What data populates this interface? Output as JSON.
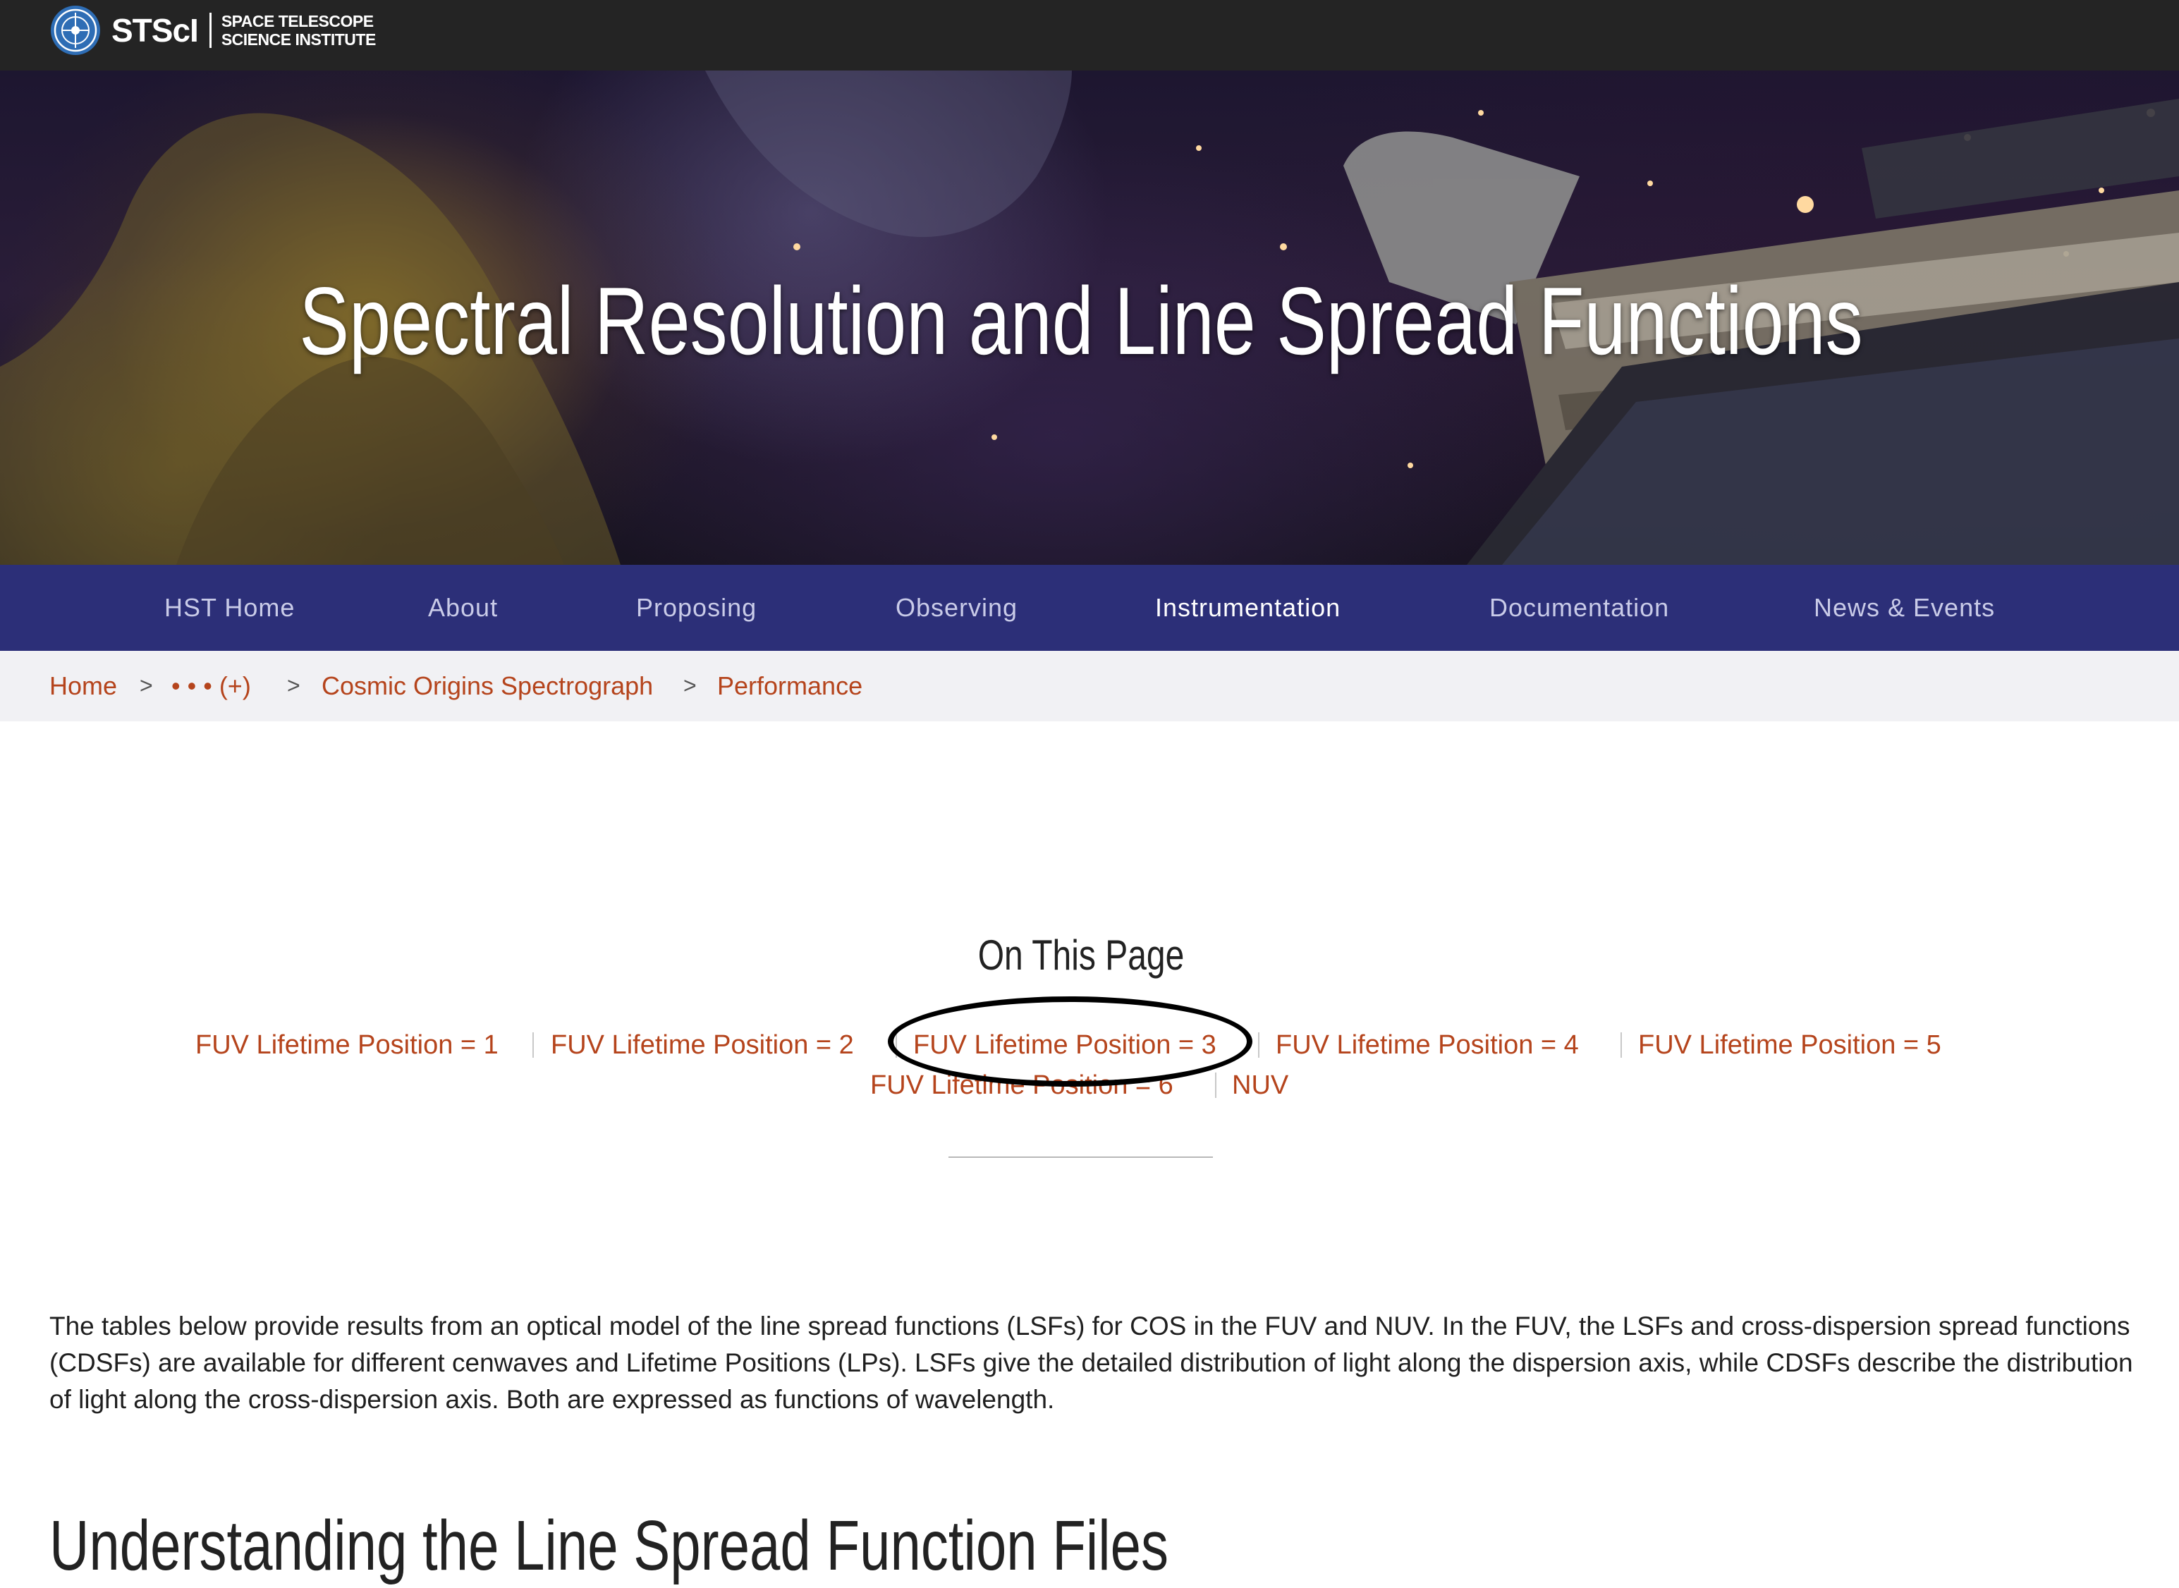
{
  "topbar": {
    "logo_text": "STScI",
    "logo_subtitle_line1": "SPACE TELESCOPE",
    "logo_subtitle_line2": "SCIENCE INSTITUTE"
  },
  "hero": {
    "title": "Spectral Resolution and Line Spread Functions"
  },
  "nav": {
    "items": [
      {
        "label": "HST Home"
      },
      {
        "label": "About"
      },
      {
        "label": "Proposing"
      },
      {
        "label": "Observing"
      },
      {
        "label": "Instrumentation",
        "active": true
      },
      {
        "label": "Documentation"
      },
      {
        "label": "News & Events"
      }
    ]
  },
  "breadcrumb": {
    "separator": ">",
    "items": [
      {
        "label": "Home"
      },
      {
        "label": "• • • (+)"
      },
      {
        "label": "Cosmic Origins Spectrograph"
      },
      {
        "label": "Performance"
      }
    ]
  },
  "on_this_page": {
    "title": "On This Page",
    "links": [
      {
        "label": "FUV Lifetime Position = 1"
      },
      {
        "label": "FUV Lifetime Position = 2"
      },
      {
        "label": "FUV Lifetime Position = 3"
      },
      {
        "label": "FUV Lifetime Position = 4"
      },
      {
        "label": "FUV Lifetime Position = 5"
      },
      {
        "label": "FUV Lifetime Position = 6"
      },
      {
        "label": "NUV"
      }
    ]
  },
  "content": {
    "intro": "The tables below provide results from an optical model of the line spread functions (LSFs) for COS in the FUV and NUV. In the FUV, the LSFs and cross-dispersion spread functions (CDSFs) are available for different cenwaves and Lifetime Positions (LPs). LSFs give the detailed distribution of light along the dispersion axis, while CDSFs describe the distribution of light along the cross-dispersion axis. Both are expressed as functions of wavelength.",
    "section_heading": "Understanding the Line Spread Function Files"
  },
  "colors": {
    "topbar": "#242424",
    "nav_background": "#2c2f78",
    "link": "#b5441c",
    "breadcrumb_background": "#f1f1f4"
  }
}
